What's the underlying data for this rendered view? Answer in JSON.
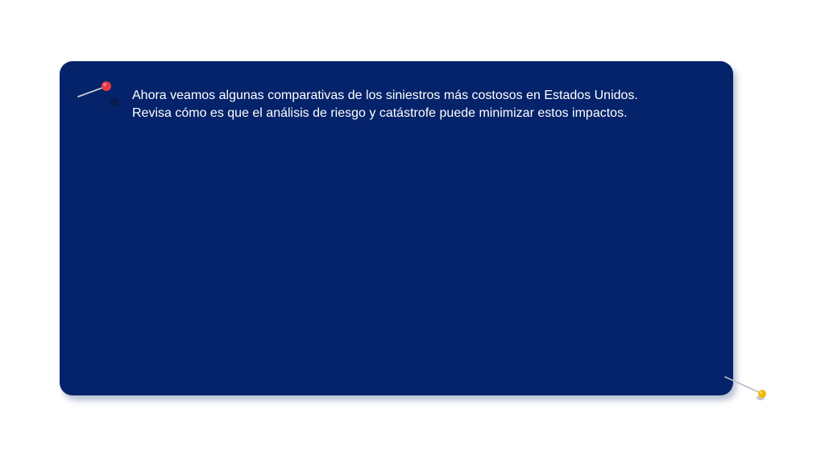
{
  "card": {
    "line1": "Ahora veamos algunas comparativas de los siniestros más costosos en Estados Unidos.",
    "line2": "Revisa cómo es que el análisis de riesgo y catástrofe puede minimizar estos impactos."
  },
  "colors": {
    "card_background": "#05236a",
    "card_text": "#ffffff",
    "pin_top_head": "#e63946",
    "pin_bottom_head": "#f2b705"
  },
  "icons": {
    "top_left": "red-push-pin-icon",
    "bottom_right": "yellow-push-pin-icon"
  }
}
